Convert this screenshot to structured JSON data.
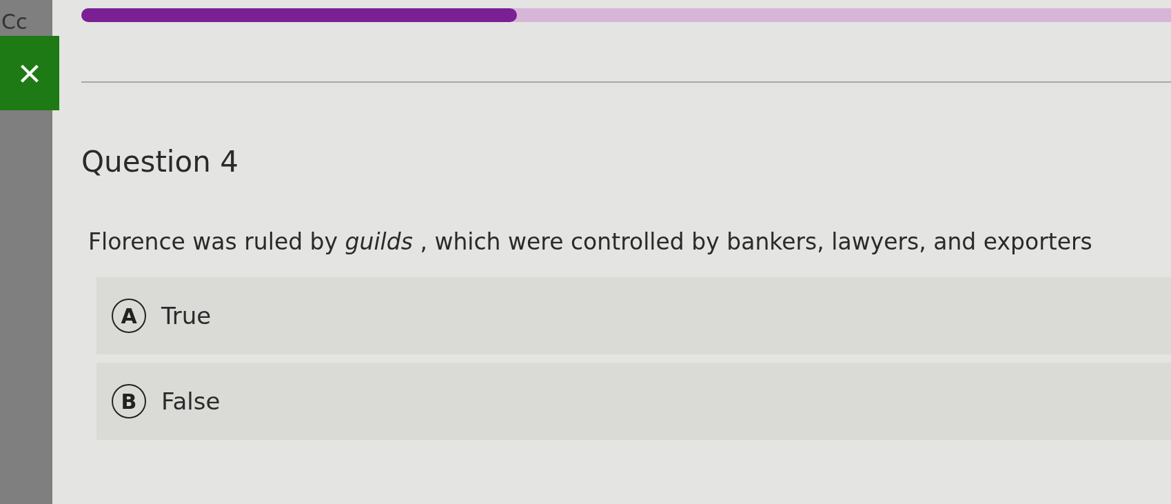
{
  "sidebar": {
    "label": "Cc"
  },
  "close_button": {
    "label": "×"
  },
  "progress": {
    "level": 0.4
  },
  "question": {
    "title": "Question 4",
    "text": "Florence was ruled by *guilds* , which were controlled by bankers, lawyers, and exporters"
  },
  "options": [
    {
      "letter": "A",
      "label": "True",
      "selected": false
    },
    {
      "letter": "B",
      "label": "False",
      "selected": false
    }
  ]
}
